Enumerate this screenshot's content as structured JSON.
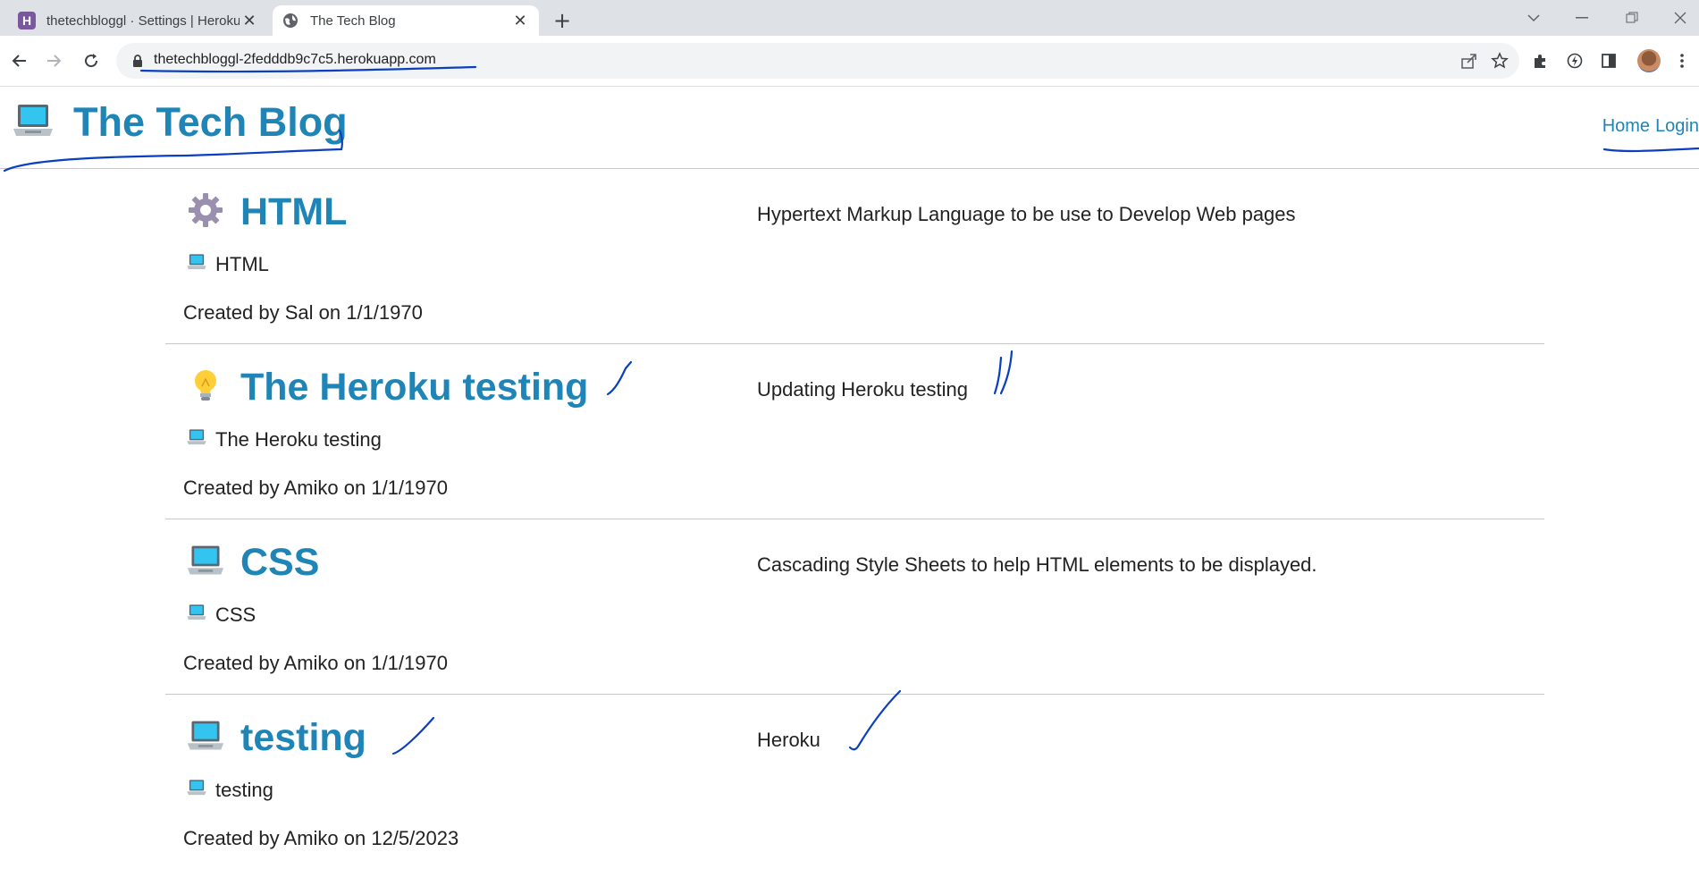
{
  "browser": {
    "tabs": [
      {
        "title": "thetechbloggl · Settings | Heroku",
        "icon": "heroku-icon",
        "active": false
      },
      {
        "title": "The Tech Blog",
        "icon": "globe-icon",
        "active": true
      }
    ],
    "url": "thetechbloggl-2fedddb9c7c5.herokuapp.com"
  },
  "site": {
    "logo_icon": "laptop-icon",
    "title": "The Tech Blog",
    "nav": {
      "home": "Home",
      "login": "Login"
    }
  },
  "posts": [
    {
      "icon": "gear-icon",
      "title": "HTML",
      "sub_icon": "laptop-icon",
      "subtitle": "HTML",
      "meta": "Created by Sal on 1/1/1970",
      "body": "Hypertext Markup Language to be use to Develop Web pages"
    },
    {
      "icon": "lightbulb-icon",
      "title": "The Heroku testing",
      "sub_icon": "laptop-icon",
      "subtitle": "The Heroku testing",
      "meta": "Created by Amiko on 1/1/1970",
      "body": "Updating Heroku testing"
    },
    {
      "icon": "laptop-icon",
      "title": "CSS",
      "sub_icon": "laptop-icon",
      "subtitle": "CSS",
      "meta": "Created by Amiko on 1/1/1970",
      "body": "Cascading Style Sheets to help HTML elements to be displayed."
    },
    {
      "icon": "laptop-icon",
      "title": "testing",
      "sub_icon": "laptop-icon",
      "subtitle": "testing",
      "meta": "Created by Amiko on 12/5/2023",
      "body": "Heroku"
    }
  ],
  "colors": {
    "link": "#1f85b6",
    "ink": "#0a3fbf",
    "tabstrip": "#dee1e6"
  }
}
